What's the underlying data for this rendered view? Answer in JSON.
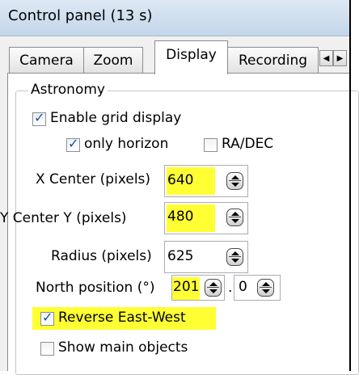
{
  "window": {
    "title": "Control panel (13 s)"
  },
  "tabs": [
    {
      "label": "Camera"
    },
    {
      "label": "Zoom"
    },
    {
      "label": "Display"
    },
    {
      "label": "Recording"
    }
  ],
  "tab_scroll": {
    "left_icon": "triangle-left-icon",
    "right_icon": "triangle-right-icon"
  },
  "group": {
    "label": "Astronomy"
  },
  "checkboxes": {
    "enable_grid": {
      "label": "Enable grid display",
      "checked": true
    },
    "only_horizon": {
      "label": "only horizon",
      "checked": true
    },
    "ra_dec": {
      "label": "RA/DEC",
      "checked": false
    },
    "reverse_ew": {
      "label": "Reverse East-West",
      "checked": true
    },
    "show_main_objects": {
      "label": "Show main objects",
      "checked": false
    }
  },
  "fields": {
    "x_center": {
      "label": "X Center (pixels)",
      "value": "640"
    },
    "y_center": {
      "label": "Y Center Y (pixels)",
      "value": "480"
    },
    "radius": {
      "label": "Radius (pixels)",
      "value": "625"
    },
    "north": {
      "label": "North position (°)",
      "value": "201",
      "decimal": "0",
      "separator": "."
    }
  },
  "highlight_color": "#ffff33",
  "check_mark": "✓"
}
